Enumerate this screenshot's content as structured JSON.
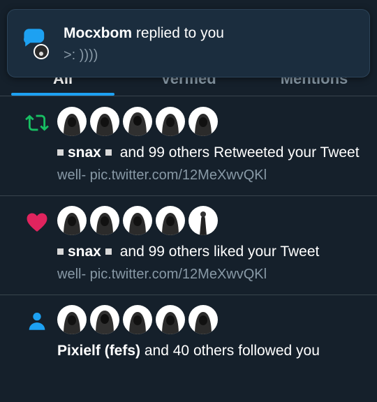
{
  "tabs": [
    "All",
    "Verified",
    "Mentions"
  ],
  "toast": {
    "username": "Mocxbom",
    "action": " replied to you",
    "message": ">: ))))"
  },
  "notifications": [
    {
      "type": "retweet",
      "icon": "retweet-icon",
      "color": "#17bf63",
      "actor": "snax",
      "text": "and 99 others Retweeted your Tweet",
      "preview": "well- pic.twitter.com/12MeXwvQKl"
    },
    {
      "type": "like",
      "icon": "heart-icon",
      "color": "#e0245e",
      "actor": "snax",
      "text": "and 99 others liked your Tweet",
      "preview": "well- pic.twitter.com/12MeXwvQKl"
    },
    {
      "type": "follow",
      "icon": "person-icon",
      "color": "#1da1f2",
      "actor": "Pixielf (fefs)",
      "text": "and 40 others followed you"
    }
  ],
  "colors": {
    "background": "#15202b",
    "accent": "#1da1f2",
    "muted": "#8899a6"
  }
}
